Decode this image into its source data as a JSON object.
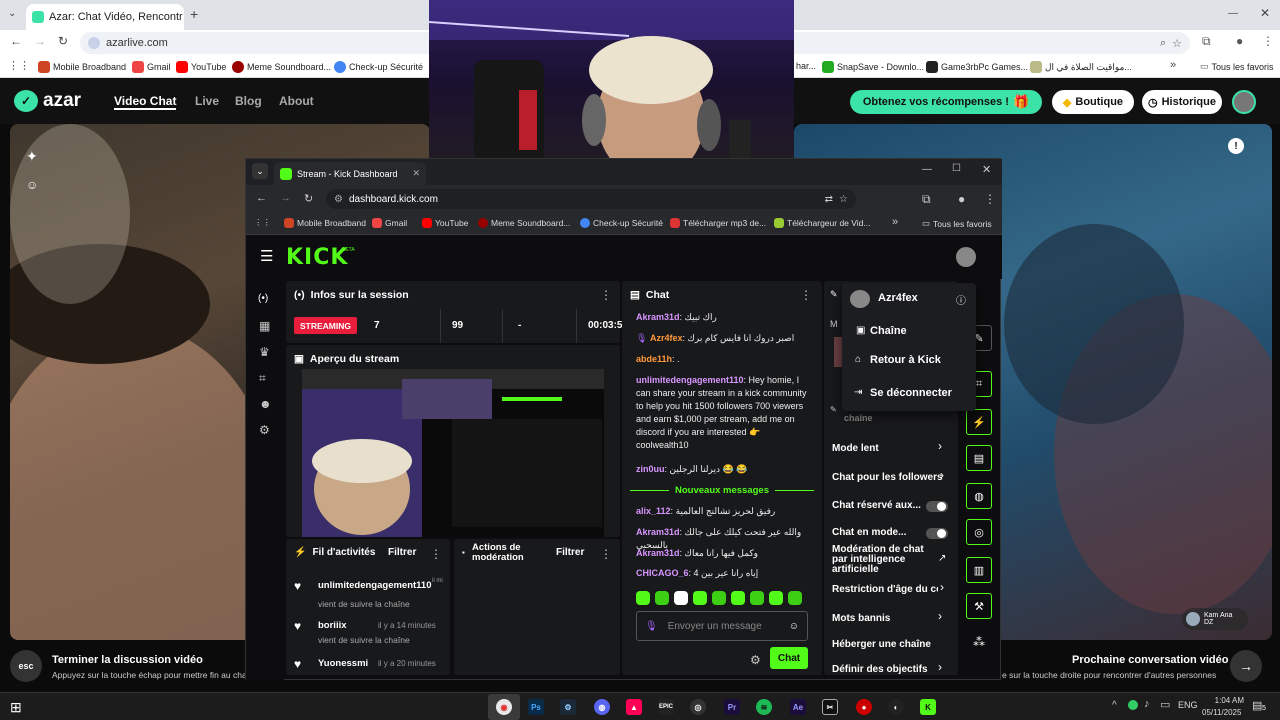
{
  "outer_browser": {
    "tab_title": "Azar: Chat Vidéo, Rencontr",
    "url": "azarlive.com",
    "bookmarks": [
      "Mobile Broadband",
      "Gmail",
      "YouTube",
      "Meme Soundboard...",
      "Check-up Sécurité",
      "har...",
      "SnapSave - Downlo...",
      "Game3rbPc Games...",
      "مواقيت الصلاة في ال...",
      "Tous les favoris"
    ]
  },
  "azar": {
    "logo": "azar",
    "nav": [
      "Video Chat",
      "Live",
      "Blog",
      "About"
    ],
    "rewards_button": "Obtenez vos récompenses !",
    "shop_button": "Boutique",
    "history_button": "Historique",
    "footer_left_key": "esc",
    "footer_left_title": "Terminer la discussion vidéo",
    "footer_left_hint": "Appuyez sur la touche échap pour mettre fin au chat",
    "footer_right_title": "Prochaine conversation vidéo",
    "footer_right_hint": "e sur la touche droite pour rencontrer d'autres personnes",
    "remote_user_name": "Kam Ana",
    "remote_user_country": "DZ",
    "colors": {
      "accent": "#3ce3a6",
      "bg": "#0b0b0b"
    }
  },
  "kick": {
    "tab_title": "Stream - Kick Dashboard",
    "url": "dashboard.kick.com",
    "bookmarks": [
      "Mobile Broadband",
      "Gmail",
      "YouTube",
      "Meme Soundboard...",
      "Check-up Sécurité",
      "Télécharger mp3 de...",
      "Téléchargeur de Vid...",
      "Tous les favoris"
    ],
    "logo": "KICK",
    "logo_badge": "BETA",
    "session": {
      "title": "Infos sur la session",
      "status": "STREAMING",
      "viewers": "7",
      "followers": "99",
      "dash": "-",
      "time": "00:03:5"
    },
    "preview_title": "Aperçu du stream",
    "activity": {
      "title": "Fil d'activités",
      "filter": "Filtrer",
      "items": [
        {
          "user": "unlimitedengagement110",
          "action": "vient de suivre la chaîne",
          "time": "il mi"
        },
        {
          "user": "boriiix",
          "action": "vient de suivre la chaîne",
          "time": "il y a 14 minutes"
        },
        {
          "user": "Yuonessmi",
          "action": "",
          "time": "il y a 20 minutes"
        }
      ]
    },
    "moderation": {
      "title": "Actions de modération",
      "filter": "Filtrer"
    },
    "chat": {
      "title": "Chat",
      "messages": [
        {
          "user": "Akram31d",
          "text": "راك تبيك",
          "color": "p"
        },
        {
          "user": "Azr4fex",
          "text": "اصبر دروك انا فايس كام برك",
          "color": "o"
        },
        {
          "user": "abde11h",
          "text": ".",
          "color": "o"
        },
        {
          "user": "unlimitedengagement110",
          "text": "Hey homie, I can share your stream in a kick community to help you hit 1500 followers 700 viewers and earn $1,000 per stream, add me on discord if you are interested 👉 coolwealth10",
          "color": "p"
        },
        {
          "user": "zin0uu",
          "text": "ديرلنا الرجلين 😂 😂",
          "color": "p"
        }
      ],
      "new_messages": "Nouveaux messages",
      "messages2": [
        {
          "user": "alix_112",
          "text": "رفيق لحريز تشالنج العالمية",
          "color": "p"
        },
        {
          "user": "Akram31d",
          "text": "والله عير فتحت كيلك على جالك بالسحبي",
          "color": "p"
        },
        {
          "user": "Akram31d",
          "text": "وكمل فيها رانا معاك",
          "color": "p"
        },
        {
          "user": "CHICAGO_6",
          "text": "إياه رانا عير بين 4",
          "color": "p"
        }
      ],
      "input_placeholder": "Envoyer un message",
      "send_label": "Chat"
    },
    "settings": {
      "channel_label": "chaîne",
      "rows": [
        "Mode lent",
        "Chat pour les followers",
        "Chat réservé aux...",
        "Chat en mode...",
        "Modération de chat par intelligence artificielle",
        "Restriction d'âge du co",
        "Mots bannis",
        "Héberger une chaîne",
        "Définir des objectifs"
      ]
    },
    "user_menu": {
      "username": "Azr4fex",
      "items": [
        "Chaîne",
        "Retour à Kick",
        "Se déconnecter"
      ]
    },
    "colors": {
      "brand": "#53fc18",
      "live": "#e91e3c",
      "panel": "#18191b"
    }
  },
  "taskbar": {
    "apps": [
      "Ps",
      "Ae",
      "Pr",
      "EPIC"
    ],
    "time": "1:04 AM",
    "date": "05/11/2025",
    "lang": "ENG",
    "notifications": "5"
  }
}
